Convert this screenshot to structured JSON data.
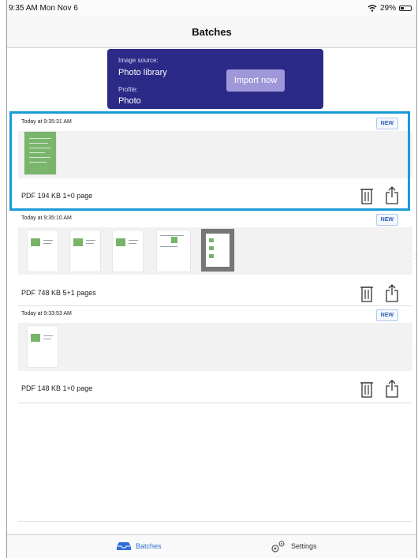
{
  "status": {
    "time": "9:35 AM  Mon Nov 6",
    "battery": "29%",
    "battery_level": 0.29
  },
  "nav": {
    "title": "Batches"
  },
  "import_card": {
    "source_label": "Image source:",
    "source_value": "Photo library",
    "profile_label": "Profile:",
    "profile_value": "Photo",
    "button_label": "Import now"
  },
  "batches": [
    {
      "timestamp": "Today at 9:35:31 AM",
      "badge": "NEW",
      "summary": "PDF  194 KB  1+0 page",
      "selected": true
    },
    {
      "timestamp": "Today at 9:35:10 AM",
      "badge": "NEW",
      "summary": "PDF  748 KB  5+1 pages",
      "selected": false
    },
    {
      "timestamp": "Today at 9:33:53 AM",
      "badge": "NEW",
      "summary": "PDF  148 KB  1+0 page",
      "selected": false
    }
  ],
  "tabs": [
    {
      "label": "Batches",
      "icon": "tray-icon",
      "active": true
    },
    {
      "label": "Settings",
      "icon": "gears-icon",
      "active": false
    }
  ],
  "colors": {
    "card": "#2b2a87",
    "button": "#9f97d9",
    "highlight": "#1a9ad6",
    "tab_active": "#2f6fd6"
  }
}
